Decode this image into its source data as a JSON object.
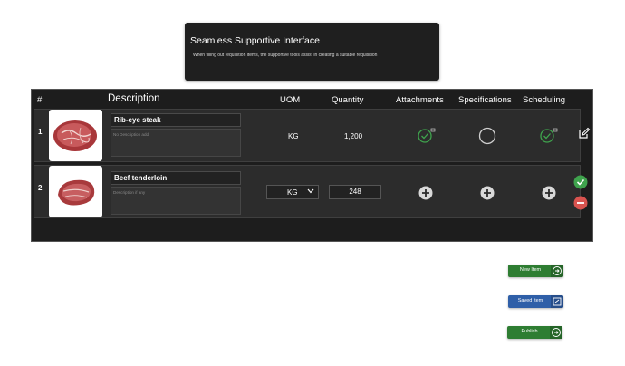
{
  "banner": {
    "title": "Seamless Supportive Interface",
    "subtitle": "When filling out requisition items, the supportive tools assist in creating a suitable requisition"
  },
  "table": {
    "headers": {
      "num": "#",
      "description": "Description",
      "uom": "UOM",
      "quantity": "Quantity",
      "attachments": "Attachments",
      "specifications": "Specifications",
      "scheduling": "Scheduling"
    },
    "rows": [
      {
        "num": "1",
        "name": "Rib-eye steak",
        "description": "No Description add",
        "uom": "KG",
        "quantity": "1,200",
        "attachments_icon": "check-circle-attached-icon",
        "specifications_icon": "empty-circle-icon",
        "scheduling_icon": "check-circle-attached-icon",
        "action_icon": "edit-icon"
      },
      {
        "num": "2",
        "name": "Beef tenderloin",
        "description_placeholder": "Description if any",
        "uom": "KG",
        "quantity": "248",
        "attachments_icon": "add-circle-icon",
        "specifications_icon": "add-circle-icon",
        "scheduling_icon": "add-circle-icon",
        "action_icons": [
          "confirm-check-icon",
          "remove-minus-icon"
        ]
      }
    ]
  },
  "actions": {
    "new_item": "New Item",
    "saved_item": "Saved item",
    "publish": "Publish"
  },
  "colors": {
    "green": "#2e7d32",
    "blue": "#2f5fa8",
    "check_green": "#3fa34d",
    "remove_red": "#d9534f"
  }
}
